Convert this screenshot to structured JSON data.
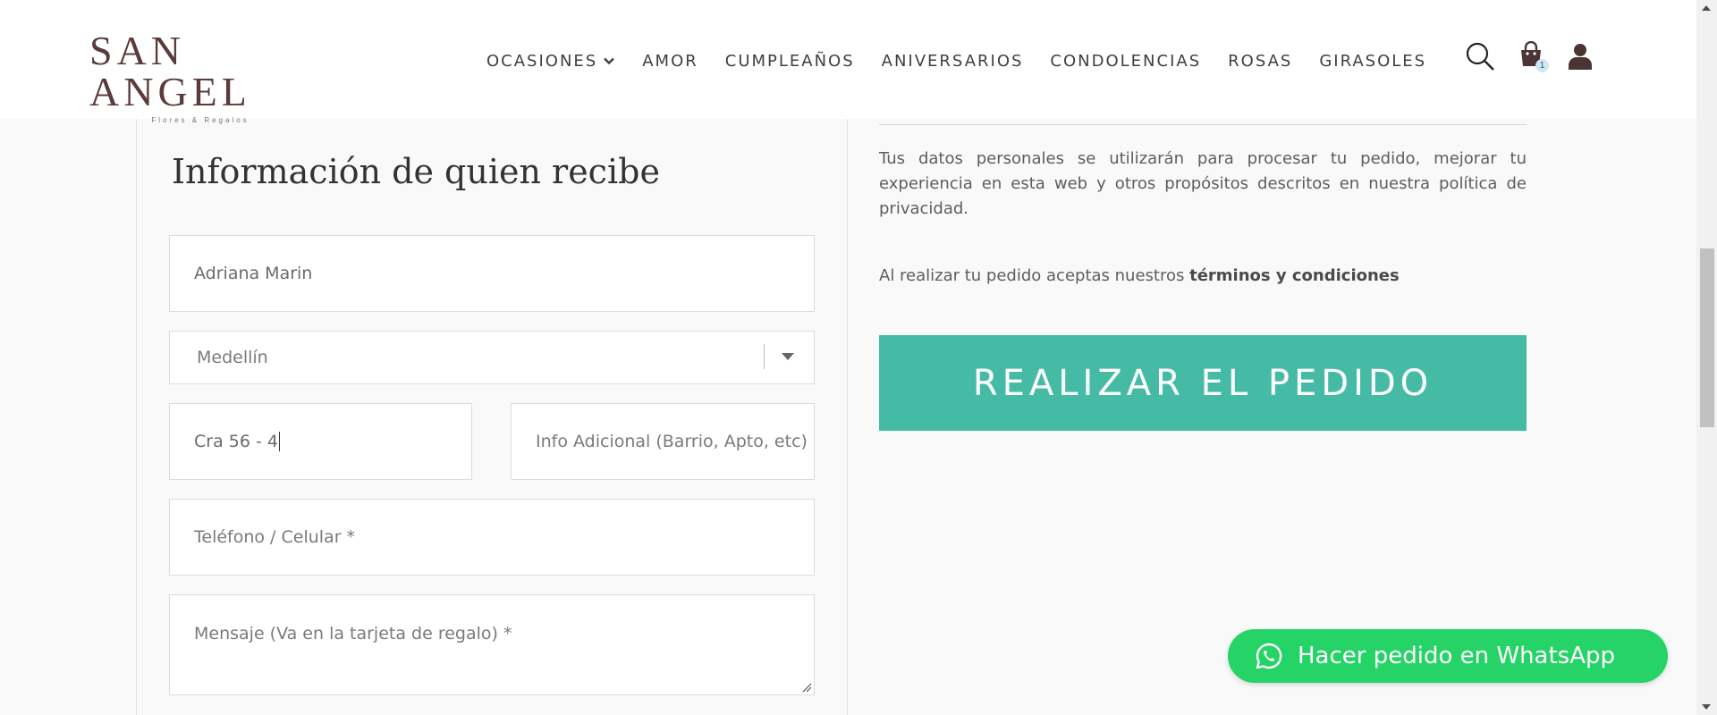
{
  "header": {
    "logo": {
      "main": "SAN ANGEL",
      "sub": "Flores & Regalos"
    },
    "nav": [
      {
        "label": "OCASIONES",
        "has_dropdown": true
      },
      {
        "label": "AMOR"
      },
      {
        "label": "CUMPLEAÑOS"
      },
      {
        "label": "ANIVERSARIOS"
      },
      {
        "label": "CONDOLENCIAS"
      },
      {
        "label": "ROSAS"
      },
      {
        "label": "GIRASOLES"
      }
    ],
    "icons": [
      "search-icon",
      "cart-icon",
      "user-icon"
    ],
    "cart_count": "1"
  },
  "form": {
    "title": "Información de quien recibe",
    "name_value": "Adriana Marin",
    "city_value": "Medellín",
    "address_value": "Cra 56 - 4",
    "additional_placeholder": "Info Adicional (Barrio, Apto, etc)",
    "phone_placeholder": "Teléfono / Celular *",
    "message_placeholder": "Mensaje (Va en la tarjeta de regalo) *"
  },
  "summary": {
    "privacy_text": "Tus datos personales se utilizarán para procesar tu pedido, mejorar tu experiencia en esta web y otros propósitos descritos en nuestra política de privacidad.",
    "terms_prefix": "Al realizar tu pedido aceptas nuestros ",
    "terms_link": "términos y condiciones",
    "order_button": "REALIZAR EL PEDIDO"
  },
  "whatsapp": {
    "label": "Hacer pedido en WhatsApp",
    "icon": "whatsapp-icon"
  },
  "colors": {
    "accent": "#45bba5",
    "whatsapp": "#25d366",
    "logo": "#5b3a3a",
    "background": "#f9f9f9"
  }
}
